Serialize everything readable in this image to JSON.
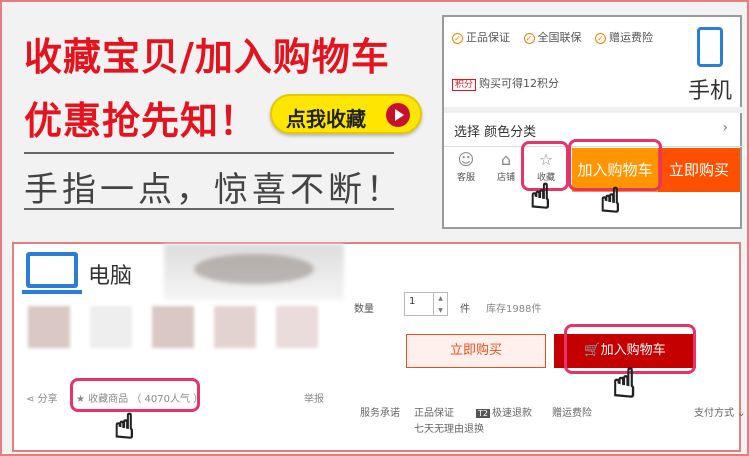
{
  "promo": {
    "line1": "收藏宝贝/加入购物车",
    "line2": "优惠抢先知！",
    "collect_button": "点我收藏",
    "tagline": "手指一点，惊喜不断！"
  },
  "mobile": {
    "guarantees": [
      "正品保证",
      "全国联保",
      "赠运费险"
    ],
    "points_tag": "积分",
    "points_text": "购买可得12积分",
    "device_label": "手机",
    "select_label": "选择  颜色分类",
    "select_chevron": "›",
    "tools": [
      {
        "label": "客服",
        "icon": "customer-service-icon"
      },
      {
        "label": "店铺",
        "icon": "store-icon"
      },
      {
        "label": "收藏",
        "icon": "star-icon"
      }
    ],
    "add_to_cart": "加入购物车",
    "buy_now": "立即购买"
  },
  "desktop": {
    "device_label": "电脑",
    "share": "分享",
    "favorite": "★ 收藏商品 （ 4070人气 ）",
    "report": "举报",
    "qty_label": "数量",
    "qty_value": "1",
    "unit": "件",
    "stock": "库存1988件",
    "buy_now": "立即购买",
    "add_to_cart": "🛒加入购物车",
    "service_label": "服务承诺",
    "services": [
      "正品保证",
      "极速退款",
      "赠运费险"
    ],
    "service_prefix": "T2",
    "return_policy": "七天无理由退换",
    "payment": "支付方式 ⌄"
  },
  "colors": {
    "accent_red": "#e4141f",
    "orange": "#ff9500",
    "buy_orange": "#ff5000",
    "desktop_red": "#c40000",
    "highlight": "#e6346b",
    "icon_blue": "#2a7fd4"
  }
}
